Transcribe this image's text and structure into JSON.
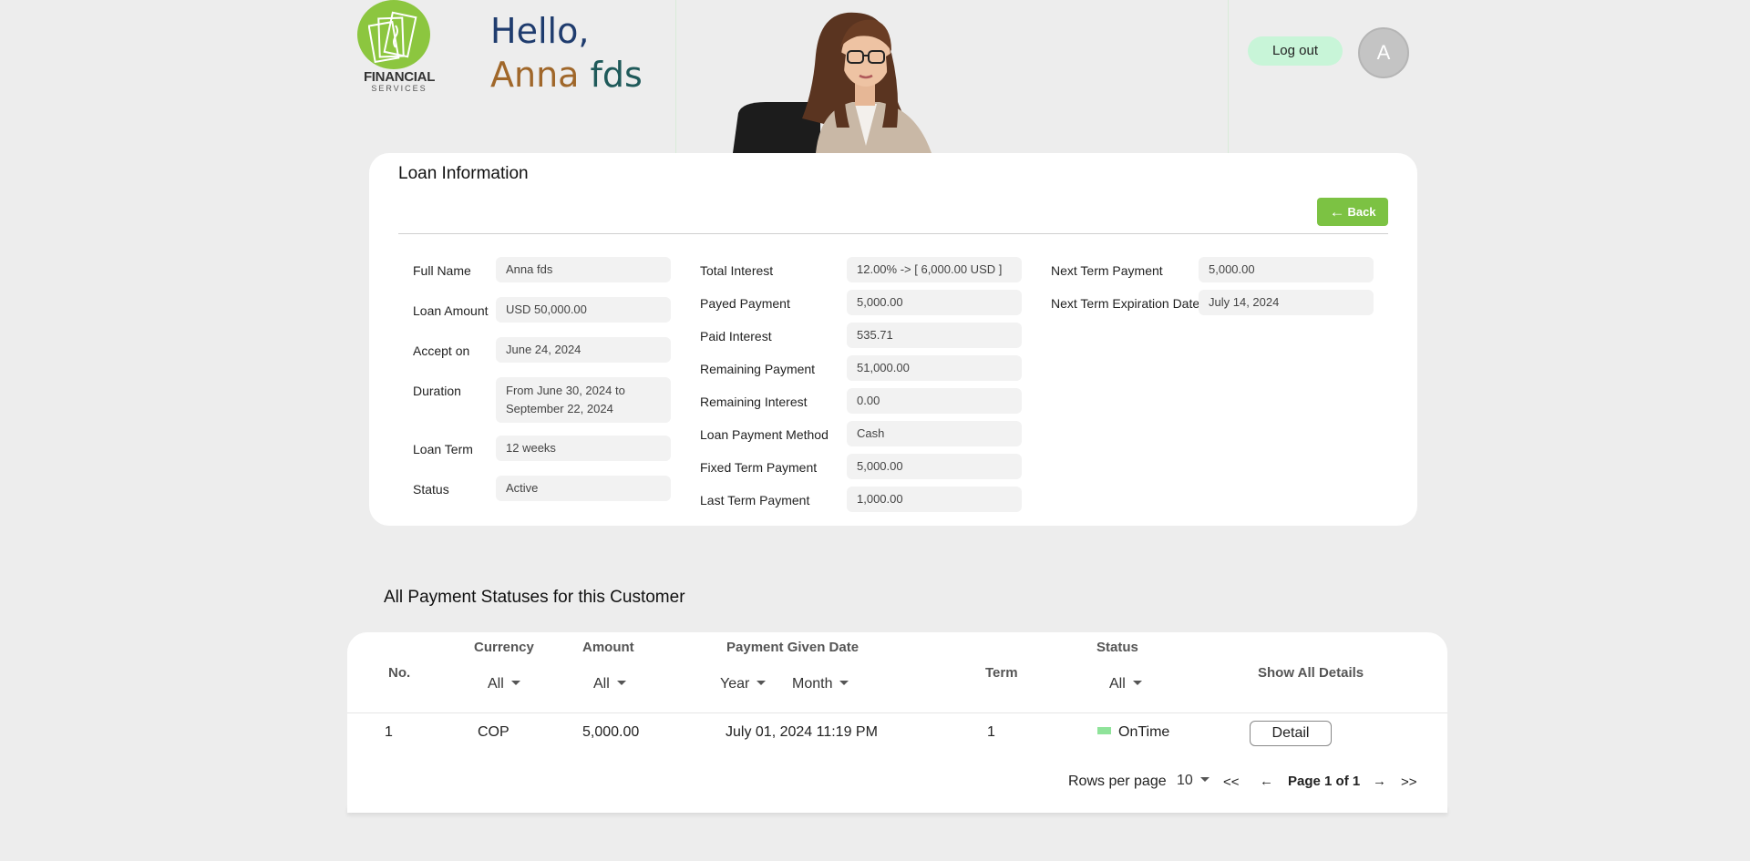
{
  "brand": {
    "line1": "FINANCIAL",
    "line2": "SERVICES",
    "logo_color": "#8cc63f"
  },
  "greeting": {
    "hello": "Hello,",
    "first_name": "Anna",
    "last_name": "fds"
  },
  "header": {
    "logout_label": "Log out",
    "avatar_initial": "A"
  },
  "loan": {
    "title": "Loan Information",
    "back_label": "Back",
    "col1": [
      {
        "label": "Full Name",
        "value": "Anna fds"
      },
      {
        "label": "Loan Amount",
        "value": "USD 50,000.00"
      },
      {
        "label": "Accept on",
        "value": "June 24, 2024"
      },
      {
        "label": "Duration",
        "value": "From June 30, 2024 to September 22, 2024"
      },
      {
        "label": "Loan Term",
        "value": "12 weeks"
      },
      {
        "label": "Status",
        "value": "Active"
      }
    ],
    "col2": [
      {
        "label": "Total Interest",
        "value": "12.00% -> [ 6,000.00 USD ]"
      },
      {
        "label": "Payed Payment",
        "value": "5,000.00"
      },
      {
        "label": "Paid Interest",
        "value": "535.71"
      },
      {
        "label": "Remaining Payment",
        "value": "51,000.00"
      },
      {
        "label": "Remaining Interest",
        "value": "0.00"
      },
      {
        "label": "Loan Payment Method",
        "value": "Cash"
      },
      {
        "label": "Fixed Term Payment",
        "value": "5,000.00"
      },
      {
        "label": "Last Term Payment",
        "value": "1,000.00"
      }
    ],
    "col3": [
      {
        "label": "Next Term Payment",
        "value": "5,000.00"
      },
      {
        "label": "Next Term Expiration Date",
        "value": "July 14, 2024"
      }
    ]
  },
  "payments": {
    "title": "All Payment Statuses for this Customer",
    "headers": {
      "no": "No.",
      "currency": "Currency",
      "amount": "Amount",
      "date": "Payment Given Date",
      "term": "Term",
      "status": "Status",
      "details": "Show All Details"
    },
    "filters": {
      "currency": "All",
      "amount": "All",
      "year": "Year",
      "month": "Month",
      "status": "All"
    },
    "rows": [
      {
        "no": "1",
        "currency": "COP",
        "amount": "5,000.00",
        "date": "July 01, 2024 11:19 PM",
        "term": "1",
        "status": "OnTime",
        "status_color": "#8fe39a",
        "action": "Detail"
      }
    ],
    "pagination": {
      "rows_per_page_label": "Rows per page",
      "rows_per_page": "10",
      "first": "<<",
      "prev": "←",
      "page_info": "Page 1 of 1",
      "next": "→",
      "last": ">>"
    }
  }
}
